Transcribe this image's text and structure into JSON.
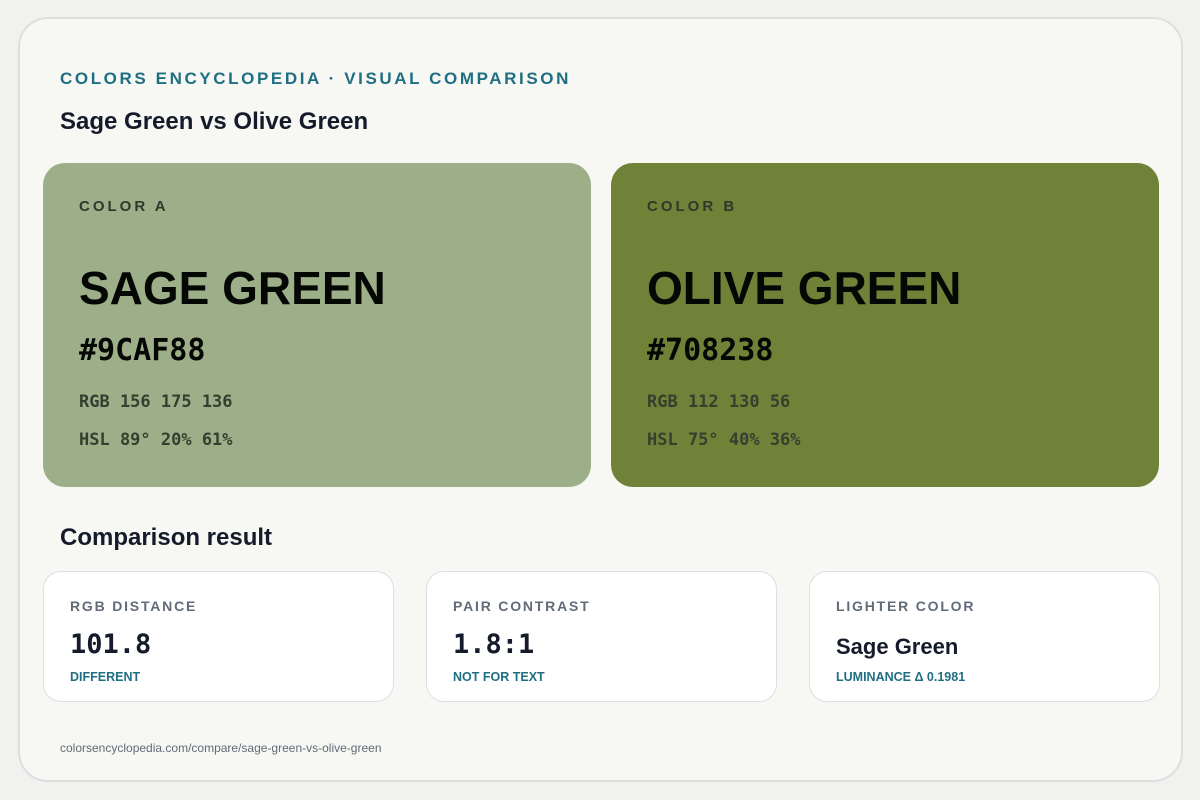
{
  "header": {
    "eyebrow": "COLORS ENCYCLOPEDIA · VISUAL COMPARISON",
    "title": "Sage Green vs Olive Green"
  },
  "colors": [
    {
      "role": "COLOR A",
      "name": "SAGE GREEN",
      "hex": "#9CAF88",
      "rgb": "RGB 156 175 136",
      "hsl": "HSL 89° 20% 61%",
      "swatch": "#9CAF88"
    },
    {
      "role": "COLOR B",
      "name": "OLIVE GREEN",
      "hex": "#708238",
      "rgb": "RGB 112 130 56",
      "hsl": "HSL 75° 40% 36%",
      "swatch": "#708238"
    }
  ],
  "comparison": {
    "title": "Comparison result",
    "stats": [
      {
        "label": "RGB DISTANCE",
        "value": "101.8",
        "note": "DIFFERENT"
      },
      {
        "label": "PAIR CONTRAST",
        "value": "1.8:1",
        "note": "NOT FOR TEXT"
      },
      {
        "label": "LIGHTER COLOR",
        "value": "Sage Green",
        "note": "LUMINANCE Δ 0.1981"
      }
    ]
  },
  "footer": {
    "url": "colorsencyclopedia.com/compare/sage-green-vs-olive-green"
  },
  "theme": {
    "accent": "#1F6F82",
    "page_background": "#F7F7F3",
    "text_dark": "#151B2B"
  }
}
